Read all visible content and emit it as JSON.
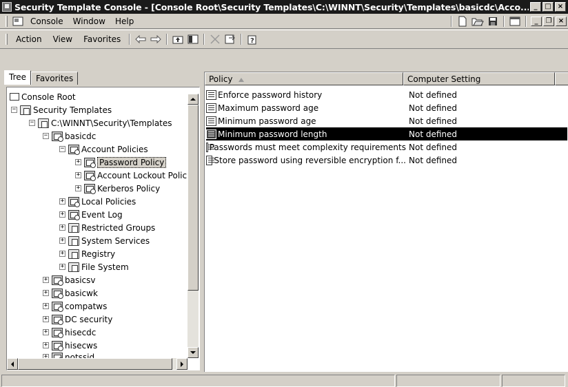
{
  "window": {
    "title": "Security Template Console - [Console Root\\Security Templates\\C:\\WINNT\\Security\\Templates\\basicdc\\Acco...",
    "minimize": "_",
    "maximize": "□",
    "close": "×"
  },
  "menubar": {
    "items": [
      "Console",
      "Window",
      "Help"
    ],
    "mdi": [
      "_",
      "❐",
      "×"
    ]
  },
  "actionbar": {
    "items": [
      "Action",
      "View",
      "Favorites"
    ]
  },
  "tabs": [
    "Tree",
    "Favorites"
  ],
  "tree": [
    {
      "label": "Console Root",
      "expander": "",
      "icon": "root"
    },
    {
      "label": "Security Templates",
      "expander": "−",
      "icon": "folder"
    },
    {
      "label": "C:\\WINNT\\Security\\Templates",
      "expander": "−",
      "icon": "folder"
    },
    {
      "label": "basicdc",
      "expander": "−",
      "icon": "policy"
    },
    {
      "label": "Account Policies",
      "expander": "−",
      "icon": "policy"
    },
    {
      "label": "Password Policy",
      "expander": "+",
      "icon": "policy",
      "selected": true
    },
    {
      "label": "Account Lockout Polic",
      "expander": "+",
      "icon": "policy"
    },
    {
      "label": "Kerberos Policy",
      "expander": "+",
      "icon": "policy"
    },
    {
      "label": "Local Policies",
      "expander": "+",
      "icon": "policy"
    },
    {
      "label": "Event Log",
      "expander": "+",
      "icon": "policy"
    },
    {
      "label": "Restricted Groups",
      "expander": "+",
      "icon": "folder"
    },
    {
      "label": "System Services",
      "expander": "+",
      "icon": "folder"
    },
    {
      "label": "Registry",
      "expander": "+",
      "icon": "folder"
    },
    {
      "label": "File System",
      "expander": "+",
      "icon": "folder"
    },
    {
      "label": "basicsv",
      "expander": "+",
      "icon": "policy"
    },
    {
      "label": "basicwk",
      "expander": "+",
      "icon": "policy"
    },
    {
      "label": "compatws",
      "expander": "+",
      "icon": "policy"
    },
    {
      "label": "DC security",
      "expander": "+",
      "icon": "policy"
    },
    {
      "label": "hisecdc",
      "expander": "+",
      "icon": "policy"
    },
    {
      "label": "hisecws",
      "expander": "+",
      "icon": "policy"
    },
    {
      "label": "notssid",
      "expander": "+",
      "icon": "policy"
    }
  ],
  "list": {
    "columns": [
      "Policy",
      "Computer Setting"
    ],
    "rows": [
      {
        "policy": "Enforce password history",
        "setting": "Not defined"
      },
      {
        "policy": "Maximum password age",
        "setting": "Not defined"
      },
      {
        "policy": "Minimum password age",
        "setting": "Not defined"
      },
      {
        "policy": "Minimum password length",
        "setting": "Not defined",
        "selected": true
      },
      {
        "policy": "Passwords must meet complexity requirements",
        "setting": "Not defined"
      },
      {
        "policy": "Store password using reversible encryption f...",
        "setting": "Not defined"
      }
    ]
  }
}
